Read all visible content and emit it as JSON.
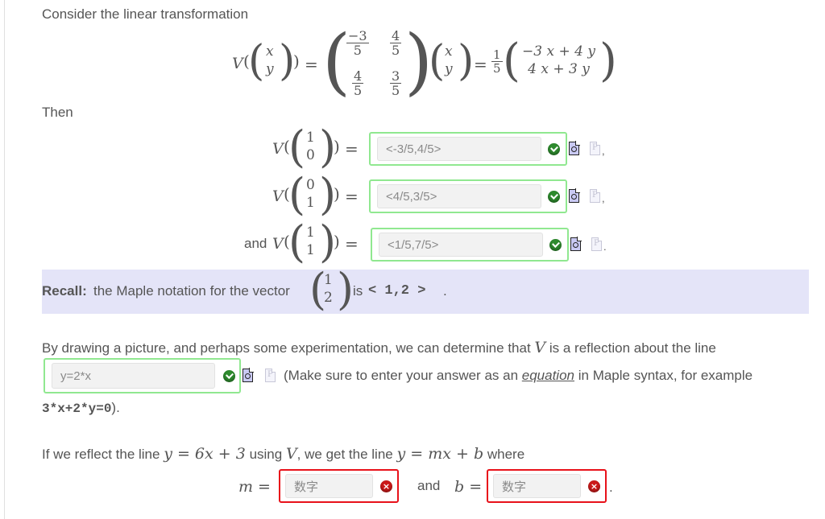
{
  "intro": {
    "text": "Consider the linear transformation",
    "definition": {
      "fn": "V",
      "input_vector": [
        "x",
        "y"
      ],
      "matrix": [
        [
          {
            "num": "−3",
            "den": "5"
          },
          {
            "num": "4",
            "den": "5"
          }
        ],
        [
          {
            "num": "4",
            "den": "5"
          },
          {
            "num": "3",
            "den": "5"
          }
        ]
      ],
      "scalar": {
        "num": "1",
        "den": "5"
      },
      "result": [
        "−3 x + 4 y",
        "4 x + 3 y"
      ]
    }
  },
  "then_label": "Then",
  "evaluations": [
    {
      "prefix": "",
      "vector": [
        "1",
        "0"
      ],
      "answer": "<-3/5,4/5>",
      "status": "correct",
      "trail": ","
    },
    {
      "prefix": "",
      "vector": [
        "0",
        "1"
      ],
      "answer": "<4/5,3/5>",
      "status": "correct",
      "trail": ","
    },
    {
      "prefix": "and",
      "vector": [
        "1",
        "1"
      ],
      "answer": "<1/5,7/5>",
      "status": "correct",
      "trail": "."
    }
  ],
  "recall": {
    "bold": "Recall:",
    "text": "the Maple notation for the vector",
    "vector": [
      "1",
      "2"
    ],
    "is": "is",
    "notation": "< 1,2 >",
    "end": "."
  },
  "reflection": {
    "text_before": "By drawing a picture, and perhaps some experimentation, we can determine that",
    "symbol": "V",
    "text_after": "is a reflection about the line",
    "answer": "y=2*x",
    "status": "correct",
    "hint_before": "(Make sure to enter your answer as an",
    "hint_link": "equation",
    "hint_after": "in Maple syntax, for example",
    "example": "3*x+2*y=0",
    "example_end": ")."
  },
  "reflect_line": {
    "text1": "If we reflect the line",
    "line_eq": "y = 6x + 3",
    "text2": "using",
    "symbol": "V",
    "text3": ", we get the line",
    "result_eq": "y = mx + b",
    "text4": "where",
    "m_label": "m =",
    "m_placeholder": "数字",
    "m_status": "incorrect",
    "and_label": "and",
    "b_label": "b =",
    "b_placeholder": "数字",
    "b_status": "incorrect",
    "end": "."
  },
  "icons": {
    "correct": "check-circle",
    "incorrect": "x-circle",
    "preview": "preview-document-magnifier",
    "plot": "plot-document-p"
  },
  "colors": {
    "correct_border": "#90e890",
    "incorrect_border": "#e8111a",
    "recall_bg": "#e4e4f8",
    "text": "#555555"
  }
}
